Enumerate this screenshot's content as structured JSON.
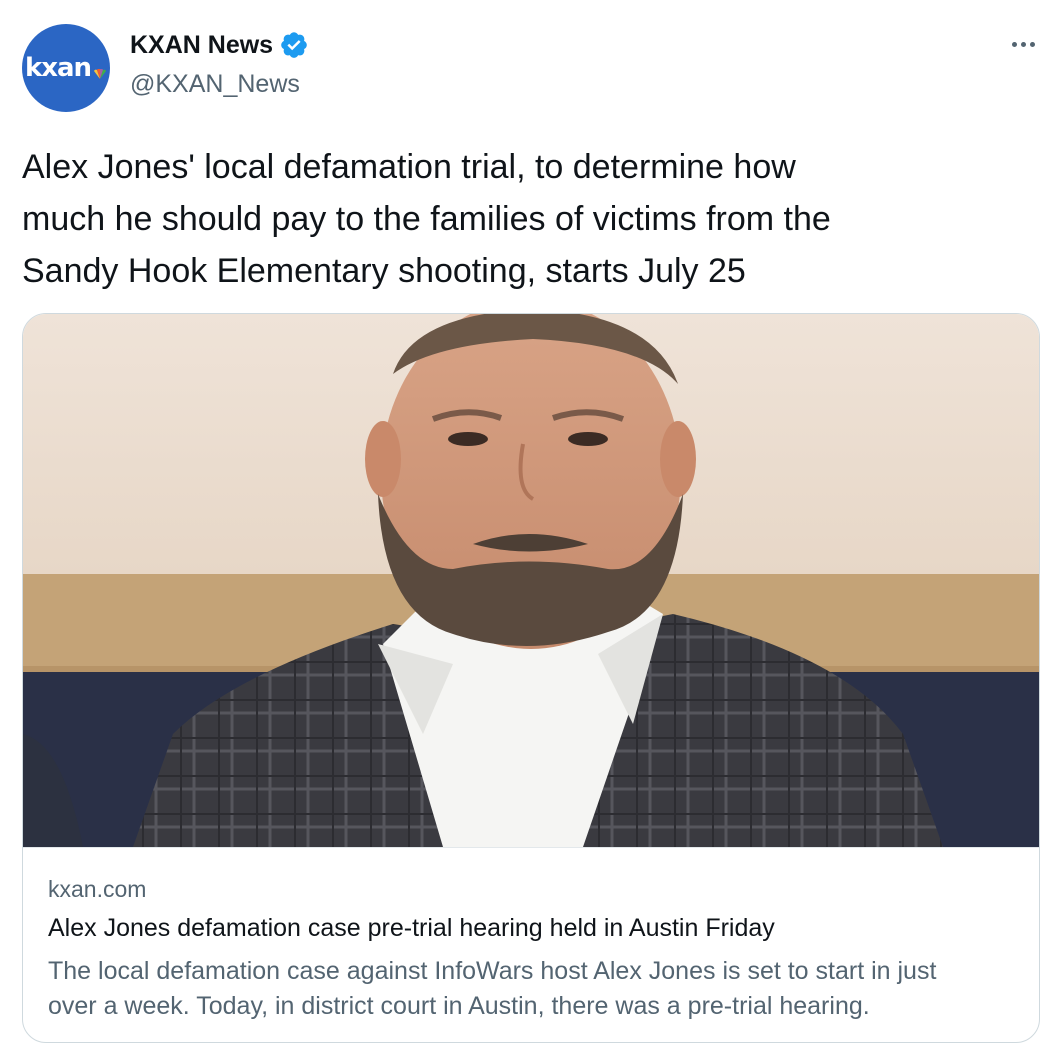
{
  "author": {
    "avatar_text": "kxan",
    "name": "KXAN News",
    "handle": "@KXAN_News",
    "verified": true,
    "verified_color": "#1d9bf0",
    "avatar_color": "#2b66c4"
  },
  "menu": {
    "icon": "more-dots-icon"
  },
  "tweet": {
    "text": "Alex Jones' local defamation trial, to determine how\nmuch he should pay to the families of victims from the\nSandy Hook Elementary shooting, starts July 25"
  },
  "card": {
    "domain": "kxan.com",
    "title": "Alex Jones defamation case pre-trial hearing held in Austin Friday",
    "description": "The local defamation case against InfoWars host Alex Jones is set to start in just\nover a week. Today, in district court in Austin, there was a pre-trial hearing."
  }
}
